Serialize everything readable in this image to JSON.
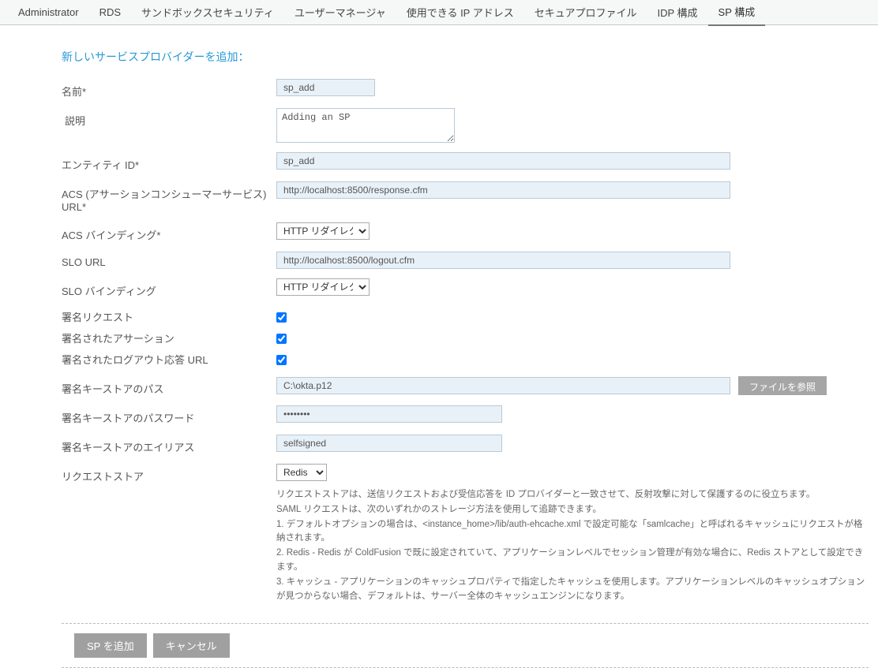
{
  "nav": {
    "items": [
      {
        "label": "Administrator"
      },
      {
        "label": "RDS"
      },
      {
        "label": "サンドボックスセキュリティ"
      },
      {
        "label": "ユーザーマネージャ"
      },
      {
        "label": "使用できる IP アドレス"
      },
      {
        "label": "セキュアプロファイル"
      },
      {
        "label": "IDP 構成"
      },
      {
        "label": "SP 構成"
      }
    ]
  },
  "section_title": "新しいサービスプロバイダーを追加：",
  "form": {
    "name": {
      "label": "名前*",
      "value": "sp_add"
    },
    "description": {
      "label": "説明",
      "value": "Adding an SP"
    },
    "entity_id": {
      "label": "エンティティ ID*",
      "value": "sp_add"
    },
    "acs_url": {
      "label": "ACS (アサーションコンシューマーサービス) URL*",
      "value": "http://localhost:8500/response.cfm"
    },
    "acs_binding": {
      "label": "ACS バインディング*",
      "value": "HTTP リダイレクト"
    },
    "slo_url": {
      "label": "SLO URL",
      "value": "http://localhost:8500/logout.cfm"
    },
    "slo_binding": {
      "label": "SLO バインディング",
      "value": "HTTP リダイレクト"
    },
    "sign_request": {
      "label": "署名リクエスト",
      "checked": true
    },
    "signed_assertion": {
      "label": "署名されたアサーション",
      "checked": true
    },
    "signed_logout": {
      "label": "署名されたログアウト応答 URL",
      "checked": true
    },
    "keystore_path": {
      "label": "署名キーストアのパス",
      "value": "C:\\okta.p12",
      "browse": "ファイルを参照"
    },
    "keystore_password": {
      "label": "署名キーストアのパスワード",
      "value": "••••••••"
    },
    "keystore_alias": {
      "label": "署名キーストアのエイリアス",
      "value": "selfsigned"
    },
    "request_store": {
      "label": "リクエストストア",
      "value": "Redis"
    }
  },
  "help": {
    "line1": "リクエストストアは、送信リクエストおよび受信応答を ID プロバイダーと一致させて、反射攻撃に対して保護するのに役立ちます。",
    "line2": "SAML リクエストは、次のいずれかのストレージ方法を使用して追跡できます。",
    "line3": "1. デフォルトオプションの場合は、<instance_home>/lib/auth-ehcache.xml で設定可能な「samlcache」と呼ばれるキャッシュにリクエストが格納されます。",
    "line4": "2. Redis - Redis が ColdFusion で既に設定されていて、アプリケーションレベルでセッション管理が有効な場合に、Redis ストアとして設定できます。",
    "line5": "3. キャッシュ - アプリケーションのキャッシュプロパティで指定したキャッシュを使用します。アプリケーションレベルのキャッシュオプションが見つからない場合、デフォルトは、サーバー全体のキャッシュエンジンになります。"
  },
  "buttons": {
    "add": "SP を追加",
    "cancel": "キャンセル"
  }
}
